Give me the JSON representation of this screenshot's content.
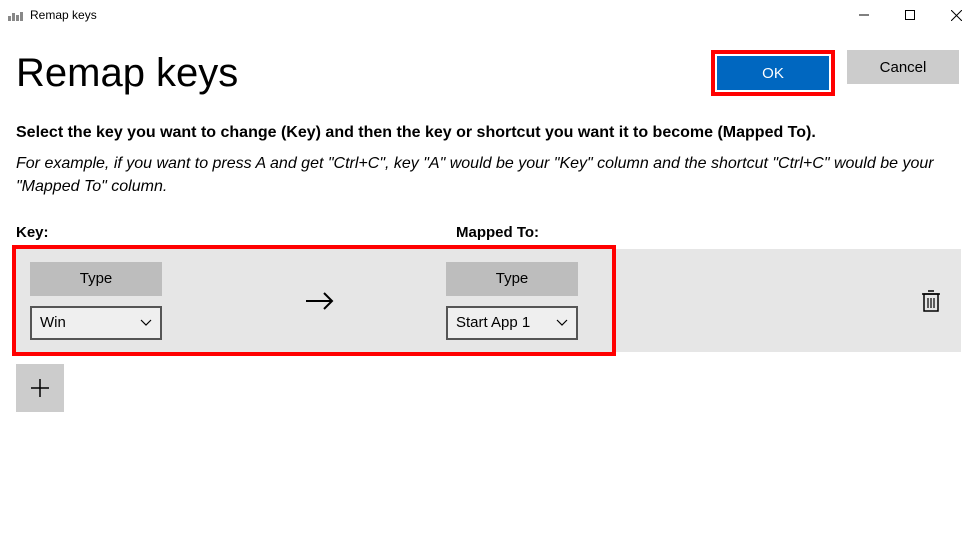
{
  "window": {
    "title": "Remap keys"
  },
  "page_title": "Remap keys",
  "buttons": {
    "ok": "OK",
    "cancel": "Cancel"
  },
  "instructions": {
    "bold": "Select the key you want to change (Key) and then the key or shortcut you want it to become (Mapped To).",
    "example": "For example, if you want to press A and get \"Ctrl+C\", key \"A\" would be your \"Key\" column and the shortcut \"Ctrl+C\" would be your \"Mapped To\" column."
  },
  "columns": {
    "key": "Key:",
    "mapped": "Mapped To:"
  },
  "row": {
    "type_label": "Type",
    "key_selected": "Win",
    "mapped_selected": "Start App 1"
  }
}
